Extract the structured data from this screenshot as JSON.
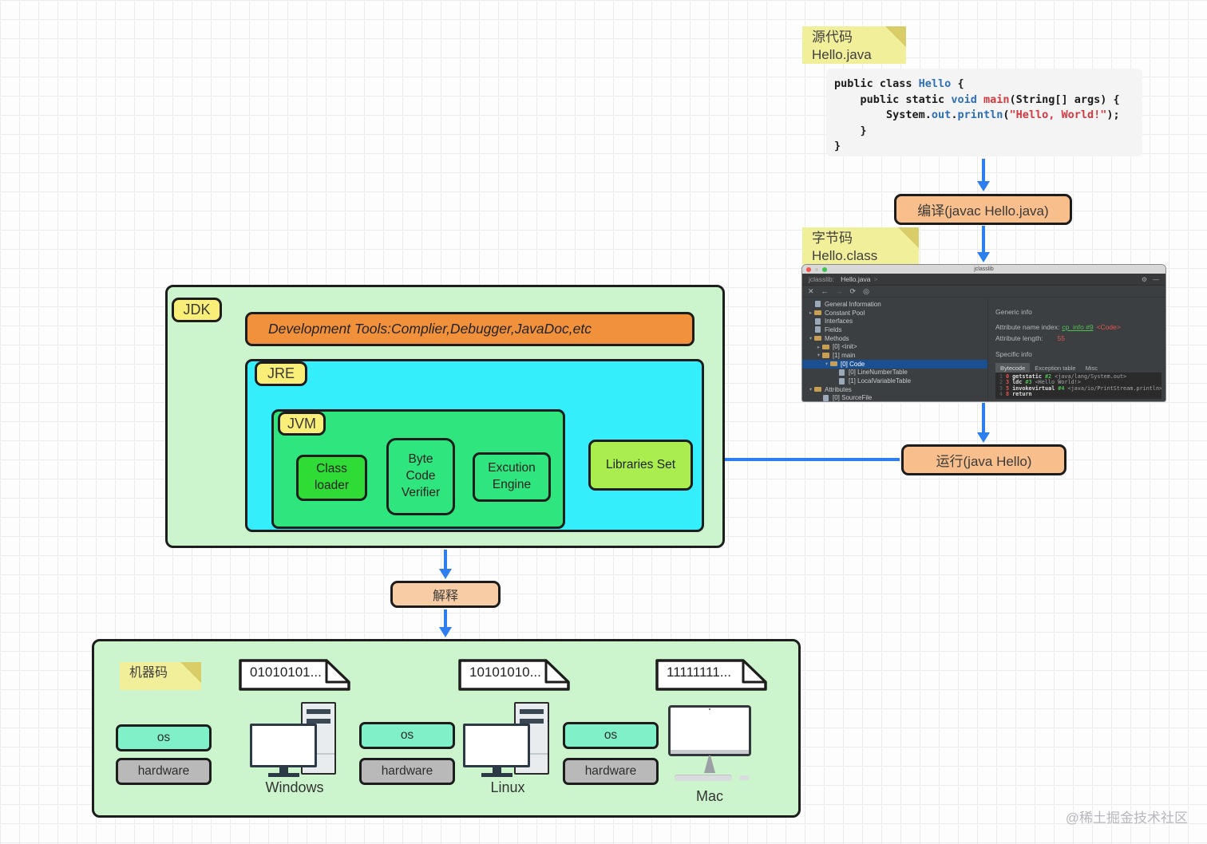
{
  "source_note": {
    "title": "源代码",
    "file": "Hello.java"
  },
  "bytecode_note": {
    "title": "字节码",
    "file": "Hello.class"
  },
  "machine_note": {
    "title": "机器码"
  },
  "code_block": {
    "lines": [
      [
        {
          "t": "public class ",
          "c": "k"
        },
        {
          "t": "Hello",
          "c": "b"
        },
        {
          "t": " {",
          "c": "p"
        }
      ],
      [
        {
          "t": "    public static ",
          "c": "k"
        },
        {
          "t": "void",
          "c": "b"
        },
        {
          "t": " ",
          "c": "p"
        },
        {
          "t": "main",
          "c": "r"
        },
        {
          "t": "(String[] args) {",
          "c": "p"
        }
      ],
      [
        {
          "t": "        System.",
          "c": "p"
        },
        {
          "t": "out",
          "c": "b"
        },
        {
          "t": ".",
          "c": "p"
        },
        {
          "t": "println",
          "c": "b"
        },
        {
          "t": "(",
          "c": "p"
        },
        {
          "t": "\"Hello, World!\"",
          "c": "r"
        },
        {
          "t": ");",
          "c": "p"
        }
      ],
      [
        {
          "t": "    }",
          "c": "p"
        }
      ],
      [
        {
          "t": "}",
          "c": "p"
        }
      ]
    ]
  },
  "flow": {
    "compile": "编译(javac Hello.java)",
    "run": "运行(java Hello)",
    "interpret": "解释"
  },
  "jdk": {
    "label": "JDK",
    "dev_tools": "Development Tools:Complier,Debugger,JavaDoc,etc",
    "jre_label": "JRE",
    "jvm_label": "JVM",
    "class_loader": "Class loader",
    "byte_code_verifier": "Byte Code Verifier",
    "execution_engine": "Excution Engine",
    "libraries_set": "Libraries Set"
  },
  "jclasslib": {
    "window_title": "jclasslib",
    "breadcrumb_app": "jclasslib:",
    "breadcrumb_file": "Hello.java",
    "breadcrumb_sep": ">",
    "toolbar_icons": [
      "✕",
      "←",
      "→",
      "⟳",
      "◎"
    ],
    "gear_icon": "⚙",
    "minimize_icon": "—",
    "tree": [
      {
        "depth": 0,
        "icon": "doc",
        "arrow": "",
        "label": "General Information",
        "selected": false
      },
      {
        "depth": 0,
        "icon": "folder",
        "arrow": "▸",
        "label": "Constant Pool",
        "selected": false
      },
      {
        "depth": 0,
        "icon": "doc",
        "arrow": "",
        "label": "Interfaces",
        "selected": false
      },
      {
        "depth": 0,
        "icon": "doc",
        "arrow": "",
        "label": "Fields",
        "selected": false
      },
      {
        "depth": 0,
        "icon": "folder",
        "arrow": "▾",
        "label": "Methods",
        "selected": false
      },
      {
        "depth": 1,
        "icon": "folder",
        "arrow": "▸",
        "label": "[0] <init>",
        "selected": false
      },
      {
        "depth": 1,
        "icon": "folder",
        "arrow": "▾",
        "label": "[1] main",
        "selected": false
      },
      {
        "depth": 2,
        "icon": "folder",
        "arrow": "▾",
        "label": "[0] Code",
        "selected": true
      },
      {
        "depth": 3,
        "icon": "doc",
        "arrow": "",
        "label": "[0] LineNumberTable",
        "selected": false
      },
      {
        "depth": 3,
        "icon": "doc",
        "arrow": "",
        "label": "[1] LocalVariableTable",
        "selected": false
      },
      {
        "depth": 0,
        "icon": "folder",
        "arrow": "▾",
        "label": "Attributes",
        "selected": false
      },
      {
        "depth": 1,
        "icon": "doc",
        "arrow": "",
        "label": "[0] SourceFile",
        "selected": false
      }
    ],
    "generic_info_title": "Generic info",
    "attr_name_label": "Attribute name index:",
    "attr_name_link": "cp_info #9",
    "attr_name_type": "<Code>",
    "attr_len_label": "Attribute length:",
    "attr_len_value": "55",
    "specific_info_title": "Specific info",
    "tabs": [
      "Bytecode",
      "Exception table",
      "Misc"
    ],
    "bytecode_lines": [
      {
        "num": "1",
        "offset": "0",
        "instr": "getstatic",
        "ref": "#2",
        "detail": "<java/lang/System.out>"
      },
      {
        "num": "2",
        "offset": "3",
        "instr": "ldc",
        "ref": "#3",
        "detail": "<Hello World!>"
      },
      {
        "num": "3",
        "offset": "5",
        "instr": "invokevirtual",
        "ref": "#4",
        "detail": "<java/io/PrintStream.println>"
      },
      {
        "num": "4",
        "offset": "8",
        "instr": "return",
        "ref": "",
        "detail": ""
      }
    ]
  },
  "platforms": {
    "files": [
      "01010101...",
      "10101010...",
      "11111111..."
    ],
    "os_label": "os",
    "hardware_label": "hardware",
    "names": [
      "Windows",
      "Linux",
      "Mac"
    ]
  },
  "watermark": "@稀土掘金技术社区",
  "colors": {
    "arrow_blue": "#2d7ff0",
    "box_green_light": "#cdf5cd",
    "jre_cyan": "#35eefb",
    "jvm_green": "#2fe57d",
    "class_loader_green": "#2edc35",
    "libraries_green": "#a9ee4e",
    "dev_tools_orange": "#f2913c",
    "flow_button_orange": "#f8bf8d",
    "interpret_orange": "#f8cda5",
    "sticky_yellow": "#f2ef9b",
    "tag_yellow": "#f9ee78"
  }
}
